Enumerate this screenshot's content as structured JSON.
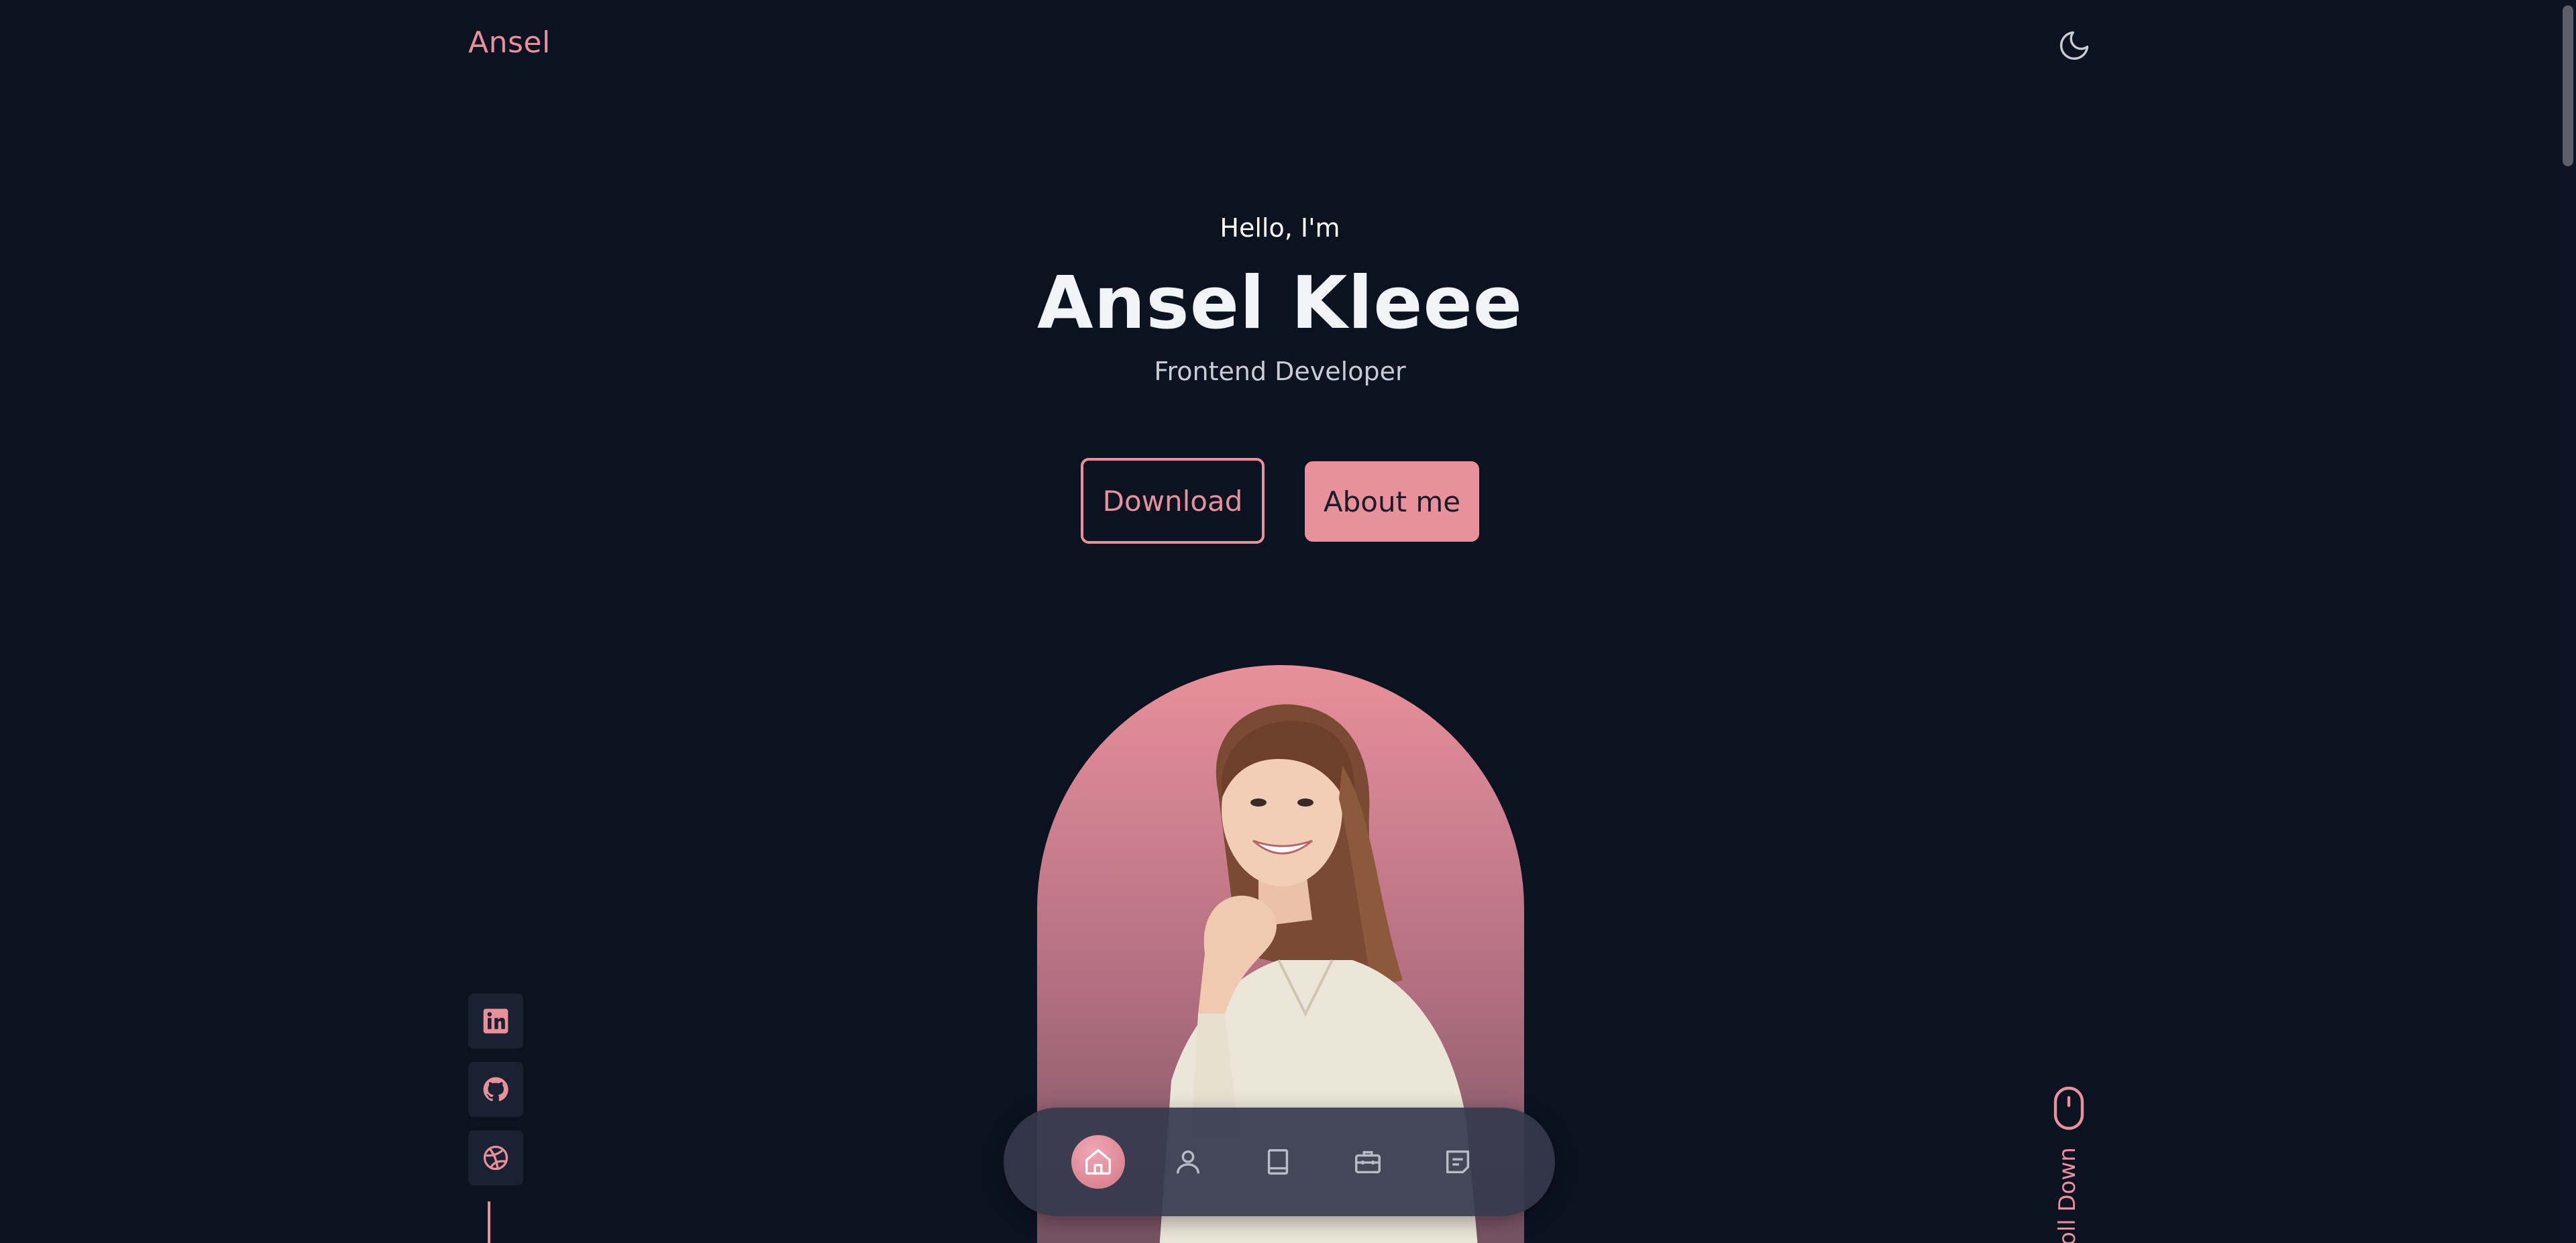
{
  "header": {
    "logo": "Ansel",
    "theme_icon": "moon-icon"
  },
  "hero": {
    "greeting": "Hello, I'm",
    "name": "Ansel Kleee",
    "role": "Frontend Developer",
    "download_label": "Download",
    "about_label": "About me"
  },
  "portrait": {
    "alt": "Portrait of smiling woman"
  },
  "social": {
    "items": [
      {
        "icon": "linkedin-icon"
      },
      {
        "icon": "github-icon"
      },
      {
        "icon": "dribbble-icon"
      }
    ]
  },
  "scroll": {
    "label": "oll Down",
    "icon": "mouse-icon"
  },
  "bottom_nav": {
    "items": [
      {
        "icon": "home-icon",
        "active": true
      },
      {
        "icon": "user-icon",
        "active": false
      },
      {
        "icon": "book-icon",
        "active": false
      },
      {
        "icon": "briefcase-icon",
        "active": false
      },
      {
        "icon": "message-icon",
        "active": false
      }
    ]
  },
  "colors": {
    "background": "#0b1220",
    "accent": "#e8909b",
    "text": "#f2f3f6"
  }
}
